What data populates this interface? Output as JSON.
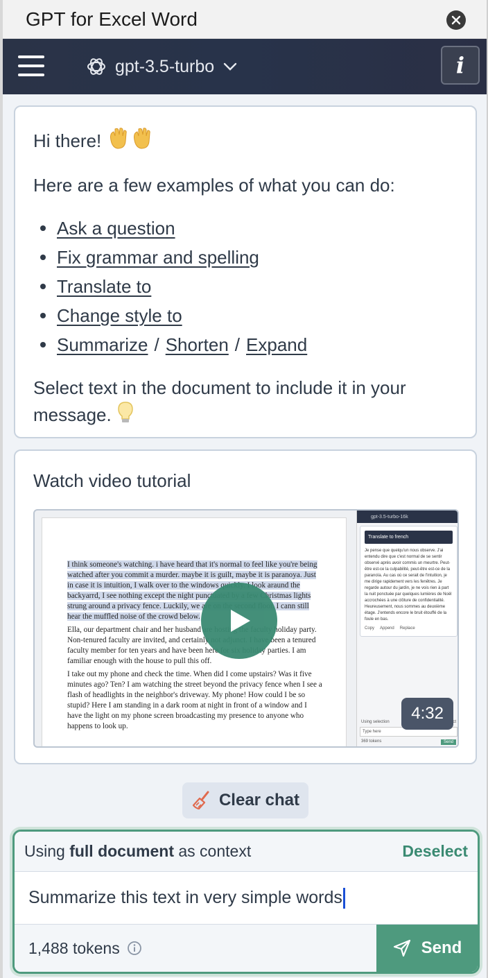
{
  "window": {
    "title": "GPT for Excel Word"
  },
  "header": {
    "model": "gpt-3.5-turbo",
    "info_label": "i"
  },
  "intro": {
    "greeting": "Hi there!",
    "lead": "Here are a few examples of what you can do:",
    "examples": [
      "Ask a question",
      "Fix grammar and spelling",
      "Translate to",
      "Change style to"
    ],
    "summarize": "Summarize",
    "shorten": "Shorten",
    "expand": "Expand",
    "separator": "/",
    "note": "Select text in the document to include it in your message."
  },
  "video": {
    "title": "Watch video tutorial",
    "duration": "4:32",
    "thumb": {
      "panel_model": "gpt-3.5-turbo-16k",
      "panel_action": "Translate to french",
      "panel_text": "Je pense que quelqu'un nous observe. J'ai entendu dire que c'est normal de se sentir observé après avoir commis un meurtre. Peut-être est-ce la culpabilité, peut-être est-ce de la paranoïa. Au cas où ce serait de l'intuition, je me dirige rapidement vers les fenêtres. Je regarde autour du jardin, je ne vois rien à part la nuit ponctuée par quelques lumières de Noël accrochées à une clôture de confidentialité. Heureusement, nous sommes au deuxième étage. J'entends encore le bruit étouffé de la foule en bas.",
      "panel_copy": "Copy",
      "panel_append": "Append",
      "panel_replace": "Replace",
      "panel_using": "Using selection",
      "panel_deselect": "Deselect",
      "panel_placeholder": "Type here",
      "panel_tokens": "369 tokens",
      "panel_send": "Send",
      "para1": "I think someone's watching. i have heard that it's normal to feel like you're being watched after you commit a murder. maybe it is guilt, maybe it is paranoya. Just in case it is intuition, I walk over to the windows quickly. I look araund the backyarrd, I see nothing except the night punctuated by a few Christmas lights strung around a privacy fence. Luckily, we are on the second floor. I cann still hear the muffled noise of the crowd below.",
      "para2": "Ella, our department chair and her husband are hosting the faculty holiday party. Non-tenured faculty are invited, and certainly not adjunct. I have been a tenured faculty member for ten years and have been here for six holiday parties. I am familiar enough with the house to pull this off.",
      "para3": "I take out my phone and check the time. When did I come upstairs? Was it five minutes ago? Ten? I am watching the street beyond the privacy fence when I see a flash of headlights in the neighbor's driveway. My phone! How could I be so stupid? Here I am standing in a dark room at night in front of a window and I have the light on my phone screen broadcasting my presence to anyone who happens to look up."
    }
  },
  "clear_chat": "Clear chat",
  "composer": {
    "context_prefix": "Using",
    "context_bold": "full document",
    "context_suffix": "as context",
    "deselect": "Deselect",
    "message": "Summarize this text in very simple words",
    "tokens": "1,488 tokens",
    "send": "Send"
  },
  "colors": {
    "accent": "#4e9a7e",
    "header_bg": "#2a3347",
    "text": "#2f3a48"
  }
}
